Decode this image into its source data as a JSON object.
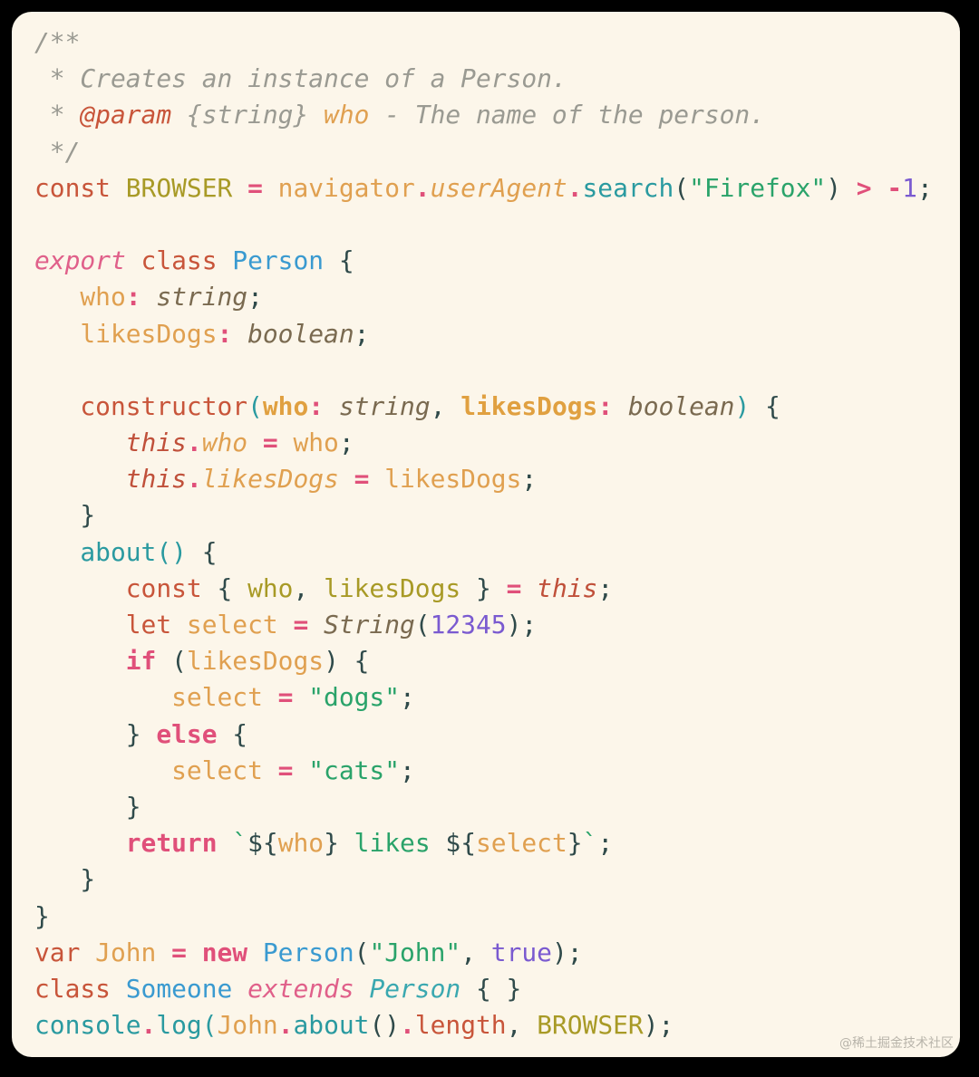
{
  "colors": {
    "background": "#fcf6ea",
    "frame": "#000000"
  },
  "watermark": "@稀土掘金技术社区",
  "lines": [
    [
      [
        "/**",
        "cm"
      ]
    ],
    [
      [
        " * Creates an instance of a Person.",
        "cm"
      ]
    ],
    [
      [
        " * ",
        "cm"
      ],
      [
        "@param",
        "cmtag"
      ],
      [
        " {string} ",
        "cm"
      ],
      [
        "who",
        "cmval"
      ],
      [
        " - The name of the person.",
        "cm"
      ]
    ],
    [
      [
        " */",
        "cm"
      ]
    ],
    [
      [
        "const ",
        "kw"
      ],
      [
        "BROWSER",
        "const"
      ],
      [
        " = ",
        "op"
      ],
      [
        "navigator",
        "prop"
      ],
      [
        ".",
        "op"
      ],
      [
        "userAgent",
        "propi"
      ],
      [
        ".",
        "op"
      ],
      [
        "search",
        "fn"
      ],
      [
        "(",
        "punc"
      ],
      [
        "\"Firefox\"",
        "str"
      ],
      [
        ") ",
        "punc"
      ],
      [
        "> ",
        "op"
      ],
      [
        "-",
        "op"
      ],
      [
        "1",
        "num"
      ],
      [
        ";",
        "punc"
      ]
    ],
    [],
    [
      [
        "export",
        "kwi"
      ],
      [
        " class ",
        "kw"
      ],
      [
        "Person",
        "cls"
      ],
      [
        " {",
        "punc"
      ]
    ],
    [
      [
        "   who",
        "prop"
      ],
      [
        ": ",
        "op"
      ],
      [
        "string",
        "type"
      ],
      [
        ";",
        "punc"
      ]
    ],
    [
      [
        "   likesDogs",
        "prop"
      ],
      [
        ": ",
        "op"
      ],
      [
        "boolean",
        "type"
      ],
      [
        ";",
        "punc"
      ]
    ],
    [],
    [
      [
        "   constructor",
        "kw"
      ],
      [
        "(",
        "paren"
      ],
      [
        "who",
        "propb"
      ],
      [
        ": ",
        "op"
      ],
      [
        "string",
        "type"
      ],
      [
        ", ",
        "punc"
      ],
      [
        "likesDogs",
        "propb"
      ],
      [
        ": ",
        "op"
      ],
      [
        "boolean",
        "type"
      ],
      [
        ")",
        "paren"
      ],
      [
        " {",
        "punc"
      ]
    ],
    [
      [
        "      this",
        "thisi"
      ],
      [
        ".",
        "op"
      ],
      [
        "who",
        "propi"
      ],
      [
        " = ",
        "op"
      ],
      [
        "who",
        "prop"
      ],
      [
        ";",
        "punc"
      ]
    ],
    [
      [
        "      this",
        "thisi"
      ],
      [
        ".",
        "op"
      ],
      [
        "likesDogs",
        "propi"
      ],
      [
        " = ",
        "op"
      ],
      [
        "likesDogs",
        "prop"
      ],
      [
        ";",
        "punc"
      ]
    ],
    [
      [
        "   }",
        "punc"
      ]
    ],
    [
      [
        "   about",
        "fn"
      ],
      [
        "()",
        "paren"
      ],
      [
        " {",
        "punc"
      ]
    ],
    [
      [
        "      const",
        "kw"
      ],
      [
        " { ",
        "punc"
      ],
      [
        "who",
        "const"
      ],
      [
        ", ",
        "punc"
      ],
      [
        "likesDogs",
        "const"
      ],
      [
        " } ",
        "punc"
      ],
      [
        "= ",
        "op"
      ],
      [
        "this",
        "thisi"
      ],
      [
        ";",
        "punc"
      ]
    ],
    [
      [
        "      let ",
        "kw"
      ],
      [
        "select",
        "prop"
      ],
      [
        " = ",
        "op"
      ],
      [
        "String",
        "type"
      ],
      [
        "(",
        "punc"
      ],
      [
        "12345",
        "num"
      ],
      [
        ");",
        "punc"
      ]
    ],
    [
      [
        "      if",
        "kwb"
      ],
      [
        " (",
        "punc"
      ],
      [
        "likesDogs",
        "prop"
      ],
      [
        ") {",
        "punc"
      ]
    ],
    [
      [
        "         select",
        "prop"
      ],
      [
        " = ",
        "op"
      ],
      [
        "\"dogs\"",
        "str"
      ],
      [
        ";",
        "punc"
      ]
    ],
    [
      [
        "      } ",
        "punc"
      ],
      [
        "else",
        "kwb"
      ],
      [
        " {",
        "punc"
      ]
    ],
    [
      [
        "         select",
        "prop"
      ],
      [
        " = ",
        "op"
      ],
      [
        "\"cats\"",
        "str"
      ],
      [
        ";",
        "punc"
      ]
    ],
    [
      [
        "      }",
        "punc"
      ]
    ],
    [
      [
        "      return",
        "kwb"
      ],
      [
        " `",
        "str"
      ],
      [
        "${",
        "punc"
      ],
      [
        "who",
        "prop"
      ],
      [
        "}",
        "punc"
      ],
      [
        " likes ",
        "str"
      ],
      [
        "${",
        "punc"
      ],
      [
        "select",
        "prop"
      ],
      [
        "}",
        "punc"
      ],
      [
        "`",
        "str"
      ],
      [
        ";",
        "punc"
      ]
    ],
    [
      [
        "   }",
        "punc"
      ]
    ],
    [
      [
        "}",
        "punc"
      ]
    ],
    [
      [
        "var ",
        "kw"
      ],
      [
        "John",
        "prop"
      ],
      [
        " = ",
        "op"
      ],
      [
        "new ",
        "kwb"
      ],
      [
        "Person",
        "cls"
      ],
      [
        "(",
        "punc"
      ],
      [
        "\"John\"",
        "str"
      ],
      [
        ", ",
        "punc"
      ],
      [
        "true",
        "num"
      ],
      [
        ");",
        "punc"
      ]
    ],
    [
      [
        "class ",
        "kw"
      ],
      [
        "Someone ",
        "cls"
      ],
      [
        "extends ",
        "kwi"
      ],
      [
        "Person",
        "clsi"
      ],
      [
        " { }",
        "punc"
      ]
    ],
    [
      [
        "console",
        "fn"
      ],
      [
        ".",
        "op"
      ],
      [
        "log",
        "fn"
      ],
      [
        "(",
        "paren"
      ],
      [
        "John",
        "prop"
      ],
      [
        ".",
        "op"
      ],
      [
        "about",
        "fn"
      ],
      [
        "()",
        "punc"
      ],
      [
        ".",
        "op"
      ],
      [
        "length",
        "kw"
      ],
      [
        ", ",
        "punc"
      ],
      [
        "BROWSER",
        "const"
      ],
      [
        ");",
        "punc"
      ]
    ]
  ]
}
